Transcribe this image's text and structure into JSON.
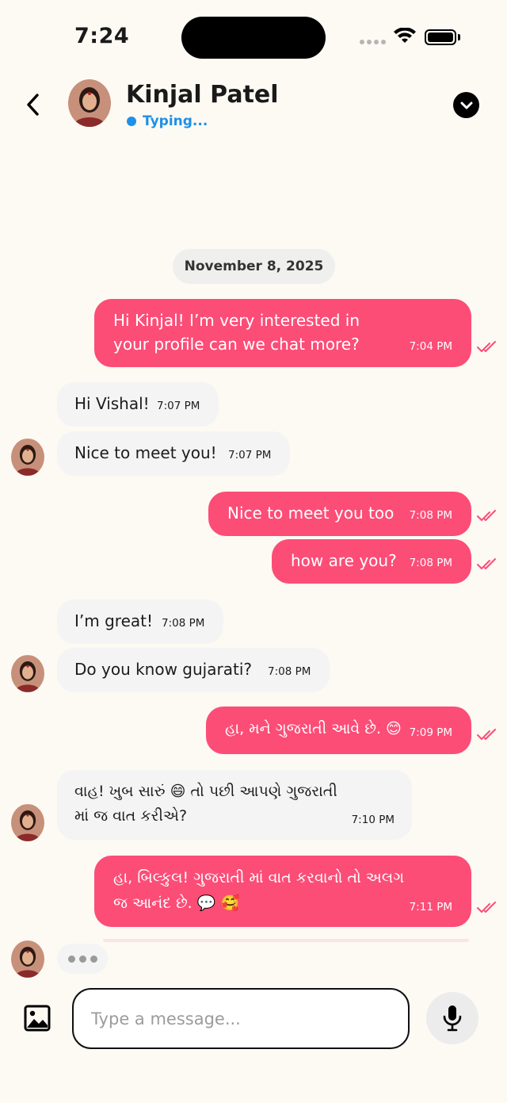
{
  "status_bar": {
    "time": "7:24"
  },
  "header": {
    "contact_name": "Kinjal Patel",
    "status_text": "Typing...",
    "status_color": "#1e90e8"
  },
  "date_separator": "November 8, 2025",
  "messages": [
    {
      "direction": "out",
      "text_lines": [
        "Hi Kinjal! I’m very interested in",
        "your profile can we chat more?"
      ],
      "time": "7:04 PM",
      "read": true
    },
    {
      "direction": "in",
      "text": "Hi Vishal!",
      "time": "7:07 PM"
    },
    {
      "direction": "in",
      "text": "Nice to meet you!",
      "time": "7:07 PM"
    },
    {
      "direction": "out",
      "text": "Nice to meet you too",
      "time": "7:08 PM",
      "read": true
    },
    {
      "direction": "out",
      "text": "how are you?",
      "time": "7:08 PM",
      "read": true
    },
    {
      "direction": "in",
      "text": "I’m great!",
      "time": "7:08 PM"
    },
    {
      "direction": "in",
      "text": "Do you know gujarati?",
      "time": "7:08 PM"
    },
    {
      "direction": "out",
      "text": "હા, મને ગુજરાતી આવે છે. 😊",
      "time": "7:09 PM",
      "read": true
    },
    {
      "direction": "in",
      "text_lines": [
        "વાહ! ખુબ સારું 😄  તો પછી આપણે ગુજરાતી",
        "માં જ વાત કરીએ?"
      ],
      "time": "7:10 PM"
    },
    {
      "direction": "out",
      "text_lines": [
        "હા, બિલ્કુલ! ગુજરાતી માં વાત કરવાનો તો અલગ",
        "જ આનંદ છે. 💬 🥰"
      ],
      "time": "7:11 PM",
      "read": true
    }
  ],
  "composer": {
    "placeholder": "Type a message..."
  },
  "colors": {
    "outgoing_bubble": "#fc4d77",
    "incoming_bubble": "#f4f4f4",
    "background": "#fdfaf4",
    "read_ticks": "#fc4d77"
  },
  "icons": {
    "back": "chevron-left-icon",
    "menu": "chevron-down-circle-icon",
    "image": "image-icon",
    "mic": "microphone-icon",
    "read": "double-check-icon"
  }
}
